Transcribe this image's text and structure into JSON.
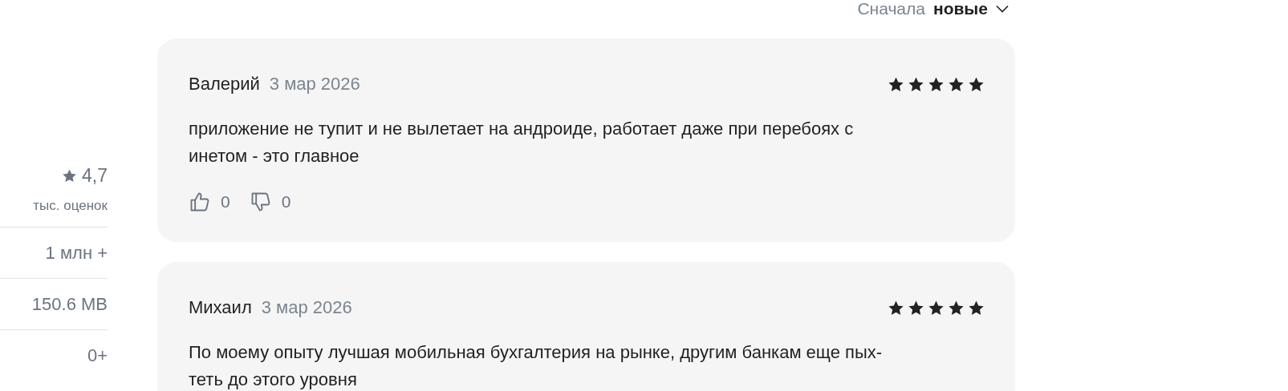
{
  "sort": {
    "label": "Сначала",
    "value": "новые"
  },
  "app_info": {
    "rating": "4,7",
    "ratings_count": "тыс. оценок",
    "installs": "1 млн +",
    "size": "150.6 MB",
    "age": "0+"
  },
  "reviews": [
    {
      "author": "Валерий",
      "date": "3 мар 2026",
      "stars": 5,
      "text_lines": [
        "приложение не тупит и не вылетает на андроиде, работает даже при перебоях с",
        "инетом - это главное"
      ],
      "likes": "0",
      "dislikes": "0"
    },
    {
      "author": "Михаил",
      "date": "3 мар 2026",
      "stars": 5,
      "text_lines": [
        "По моему опыту лучшая мобильная бухгалтерия на рынке, другим банкам еще пых-",
        "теть до этого уровня"
      ]
    }
  ]
}
